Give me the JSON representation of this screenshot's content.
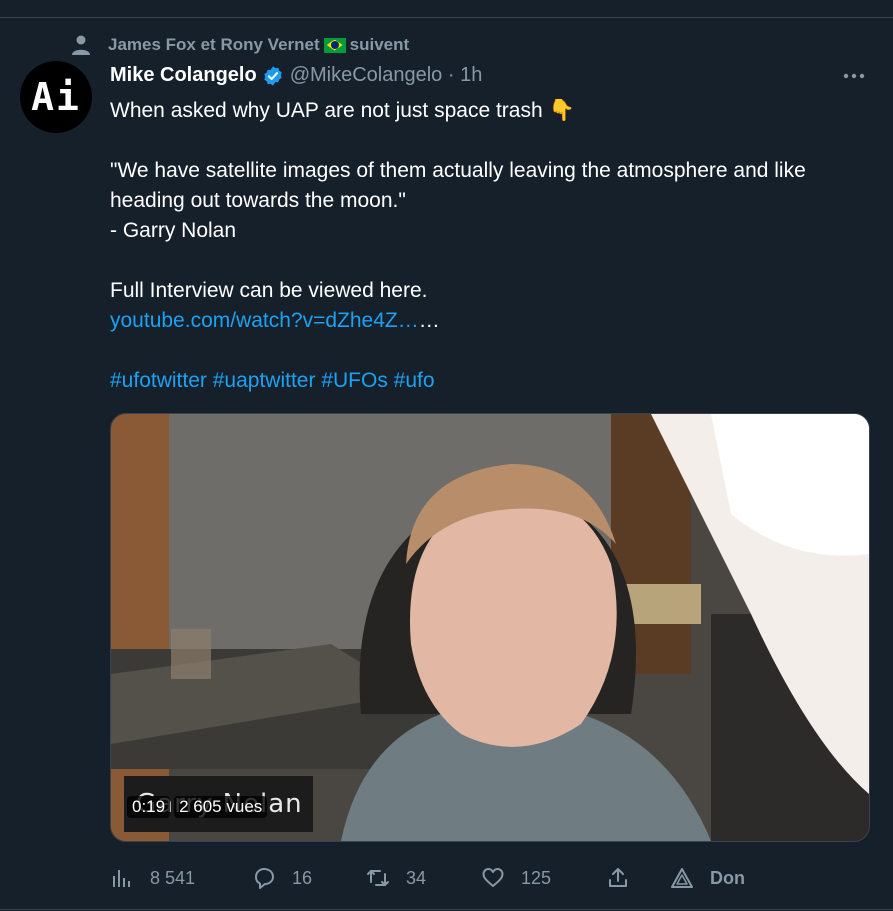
{
  "social_context": {
    "text_before_flag": "James Fox et Rony Vernet",
    "text_after_flag": "suivent"
  },
  "avatar": {
    "text": "Ai"
  },
  "author": {
    "name": "Mike Colangelo",
    "handle": "@MikeColangelo",
    "separator": " · ",
    "time": "1h"
  },
  "tweet": {
    "line1": "When asked why UAP are not just space trash 👇",
    "quote": "\"We have satellite images of them actually leaving the atmosphere and like heading out towards the moon.\"",
    "attribution": "- Garry Nolan",
    "cta": "Full Interview can be viewed here.",
    "link": "youtube.com/watch?v=dZhe4Z…",
    "link_suffix": "…",
    "hashtags": [
      "#ufotwitter",
      "#uaptwitter",
      "#UFOs",
      "#ufo"
    ]
  },
  "media": {
    "caption_text": "Garry Nolan",
    "duration": "0:19",
    "views": "2 605 vues"
  },
  "actions": {
    "views": "8 541",
    "replies": "16",
    "retweets": "34",
    "likes": "125",
    "donate": "Don"
  },
  "colors": {
    "background": "#15202b",
    "muted": "#8899a6",
    "link": "#1da1f2",
    "verified": "#1d9bf0"
  }
}
